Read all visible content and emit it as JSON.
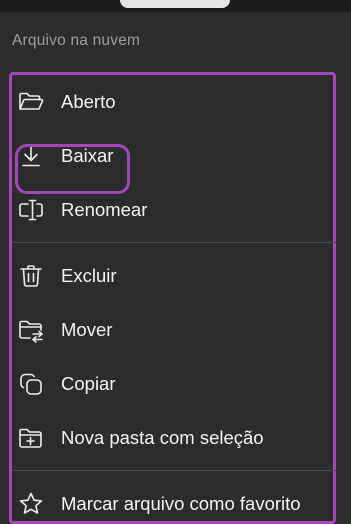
{
  "menu": {
    "header": "Arquivo na nuvem",
    "accent_color": "#a347ba",
    "items": [
      {
        "label": "Aberto",
        "icon": "folder-open-icon"
      },
      {
        "label": "Baixar",
        "icon": "download-icon"
      },
      {
        "label": "Renomear",
        "icon": "rename-icon"
      },
      {
        "label": "Excluir",
        "icon": "trash-icon"
      },
      {
        "label": "Mover",
        "icon": "folder-move-icon"
      },
      {
        "label": "Copiar",
        "icon": "copy-icon"
      },
      {
        "label": "Nova pasta com seleção",
        "icon": "folder-add-icon"
      },
      {
        "label": "Marcar arquivo como favorito",
        "icon": "star-icon"
      }
    ]
  }
}
